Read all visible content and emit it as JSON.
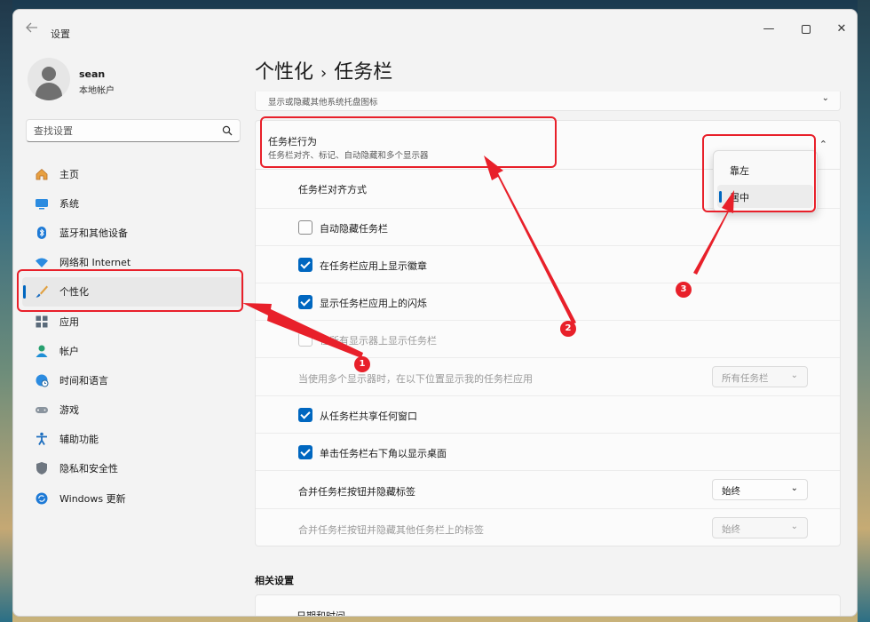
{
  "window": {
    "title": "设置",
    "back_icon": "arrow-left-icon",
    "controls": {
      "minimize": "—",
      "close": "✕"
    }
  },
  "user": {
    "name": "sean",
    "account_type": "本地帐户"
  },
  "search": {
    "placeholder": "查找设置"
  },
  "sidebar": {
    "items": [
      {
        "label": "主页",
        "icon": "home-icon"
      },
      {
        "label": "系统",
        "icon": "system-icon"
      },
      {
        "label": "蓝牙和其他设备",
        "icon": "bluetooth-icon"
      },
      {
        "label": "网络和 Internet",
        "icon": "wifi-icon"
      },
      {
        "label": "个性化",
        "icon": "brush-icon",
        "selected": true
      },
      {
        "label": "应用",
        "icon": "apps-icon"
      },
      {
        "label": "帐户",
        "icon": "account-icon"
      },
      {
        "label": "时间和语言",
        "icon": "globe-clock-icon"
      },
      {
        "label": "游戏",
        "icon": "gamepad-icon"
      },
      {
        "label": "辅助功能",
        "icon": "accessibility-icon"
      },
      {
        "label": "隐私和安全性",
        "icon": "shield-icon"
      },
      {
        "label": "Windows 更新",
        "icon": "update-icon"
      }
    ]
  },
  "main": {
    "breadcrumb": {
      "parent": "个性化",
      "separator": "›",
      "current": "任务栏"
    },
    "top_partial_text": "显示或隐藏其他系统托盘图标",
    "behavior": {
      "title": "任务栏行为",
      "subtitle": "任务栏对齐、标记、自动隐藏和多个显示器",
      "alignment_label": "任务栏对齐方式",
      "alignment_options": [
        "靠左",
        "居中"
      ],
      "alignment_selected": "居中",
      "auto_hide": "自动隐藏任务栏",
      "show_badges": "在任务栏应用上显示徽章",
      "show_flashing": "显示任务栏应用上的闪烁",
      "all_displays": "在所有显示器上显示任务栏",
      "multi_display_label": "当使用多个显示器时，在以下位置显示我的任务栏应用",
      "multi_display_value": "所有任务栏",
      "share_window": "从任务栏共享任何窗口",
      "click_corner": "单击任务栏右下角以显示桌面",
      "combine_label": "合并任务栏按钮并隐藏标签",
      "combine_value": "始终",
      "combine_other_label": "合并任务栏按钮并隐藏其他任务栏上的标签",
      "combine_other_value": "始终"
    },
    "related_title": "相关设置",
    "related_item": "日期和时间"
  },
  "annotations": {
    "badges": [
      "1",
      "2",
      "3"
    ],
    "color": "#e8202a"
  },
  "colors": {
    "accent": "#0067c0",
    "annotation": "#e8202a"
  }
}
